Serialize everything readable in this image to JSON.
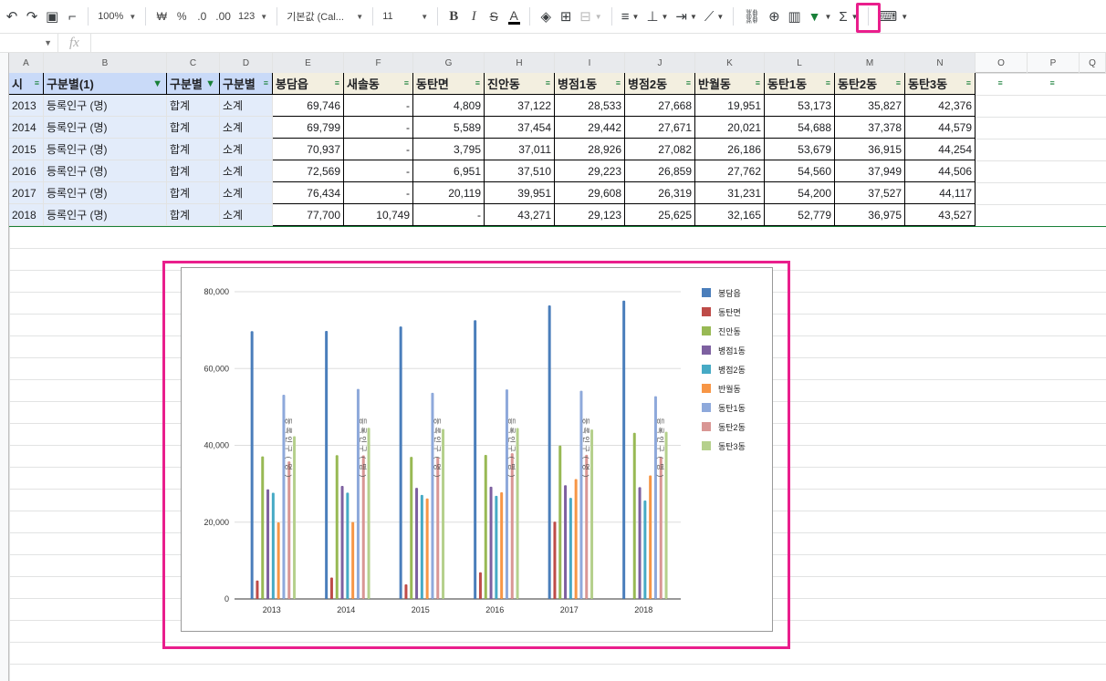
{
  "toolbar": {
    "zoom": "100%",
    "currency": "₩",
    "percent": "%",
    "dec_decrease": ".0",
    "dec_increase": ".00",
    "more_formats": "123",
    "font": "기본값 (Cal...",
    "font_size": "11",
    "bold": "B",
    "italic": "I",
    "strike": "S",
    "text_color": "A",
    "sum": "Σ"
  },
  "formula_bar": {
    "fx": "fx",
    "value": ""
  },
  "columns": [
    "A",
    "B",
    "C",
    "D",
    "E",
    "F",
    "G",
    "H",
    "I",
    "J",
    "K",
    "L",
    "M",
    "N",
    "O",
    "P",
    "Q"
  ],
  "headers": [
    "시",
    "구분별(1)",
    "구분별",
    "구분별",
    "봉담읍",
    "새솔동",
    "동탄면",
    "진안동",
    "병점1동",
    "병점2동",
    "반월동",
    "동탄1동",
    "동탄2동",
    "동탄3동"
  ],
  "rows": [
    [
      "2013",
      "등록인구 (명)",
      "합계",
      "소계",
      "69,746",
      "-",
      "4,809",
      "37,122",
      "28,533",
      "27,668",
      "19,951",
      "53,173",
      "35,827",
      "42,376"
    ],
    [
      "2014",
      "등록인구 (명)",
      "합계",
      "소계",
      "69,799",
      "-",
      "5,589",
      "37,454",
      "29,442",
      "27,671",
      "20,021",
      "54,688",
      "37,378",
      "44,579"
    ],
    [
      "2015",
      "등록인구 (명)",
      "합계",
      "소계",
      "70,937",
      "-",
      "3,795",
      "37,011",
      "28,926",
      "27,082",
      "26,186",
      "53,679",
      "36,915",
      "44,254"
    ],
    [
      "2016",
      "등록인구 (명)",
      "합계",
      "소계",
      "72,569",
      "-",
      "6,951",
      "37,510",
      "29,223",
      "26,859",
      "27,762",
      "54,560",
      "37,949",
      "44,506"
    ],
    [
      "2017",
      "등록인구 (명)",
      "합계",
      "소계",
      "76,434",
      "-",
      "20,119",
      "39,951",
      "29,608",
      "26,319",
      "31,231",
      "54,200",
      "37,527",
      "44,117"
    ],
    [
      "2018",
      "등록인구 (명)",
      "합계",
      "소계",
      "77,700",
      "10,749",
      "-",
      "43,271",
      "29,123",
      "25,625",
      "32,165",
      "52,779",
      "36,975",
      "43,527"
    ]
  ],
  "chart_data": {
    "type": "bar",
    "categories": [
      "2013",
      "2014",
      "2015",
      "2016",
      "2017",
      "2018"
    ],
    "ylim": [
      0,
      80000
    ],
    "y_ticks": [
      "0",
      "20,000",
      "40,000",
      "60,000",
      "80,000"
    ],
    "legend": "right",
    "grid": true,
    "overlay_label": "등록인구(명)",
    "series": [
      {
        "name": "봉담읍",
        "color": "#4a7ebb",
        "values": [
          69746,
          69799,
          70937,
          72569,
          76434,
          77700
        ]
      },
      {
        "name": "동탄면",
        "color": "#be4b48",
        "values": [
          4809,
          5589,
          3795,
          6951,
          20119,
          0
        ]
      },
      {
        "name": "진안동",
        "color": "#98b954",
        "values": [
          37122,
          37454,
          37011,
          37510,
          39951,
          43271
        ]
      },
      {
        "name": "병점1동",
        "color": "#7d60a0",
        "values": [
          28533,
          29442,
          28926,
          29223,
          29608,
          29123
        ]
      },
      {
        "name": "병점2동",
        "color": "#46aac5",
        "values": [
          27668,
          27671,
          27082,
          26859,
          26319,
          25625
        ]
      },
      {
        "name": "반월동",
        "color": "#f79646",
        "values": [
          19951,
          20021,
          26186,
          27762,
          31231,
          32165
        ]
      },
      {
        "name": "동탄1동",
        "color": "#8ea9db",
        "values": [
          53173,
          54688,
          53679,
          54560,
          54200,
          52779
        ]
      },
      {
        "name": "동탄2동",
        "color": "#d99694",
        "values": [
          35827,
          37378,
          36915,
          37949,
          37527,
          36975
        ]
      },
      {
        "name": "동탄3동",
        "color": "#b5d08c",
        "values": [
          42376,
          44579,
          44254,
          44506,
          44117,
          43527
        ]
      }
    ]
  }
}
